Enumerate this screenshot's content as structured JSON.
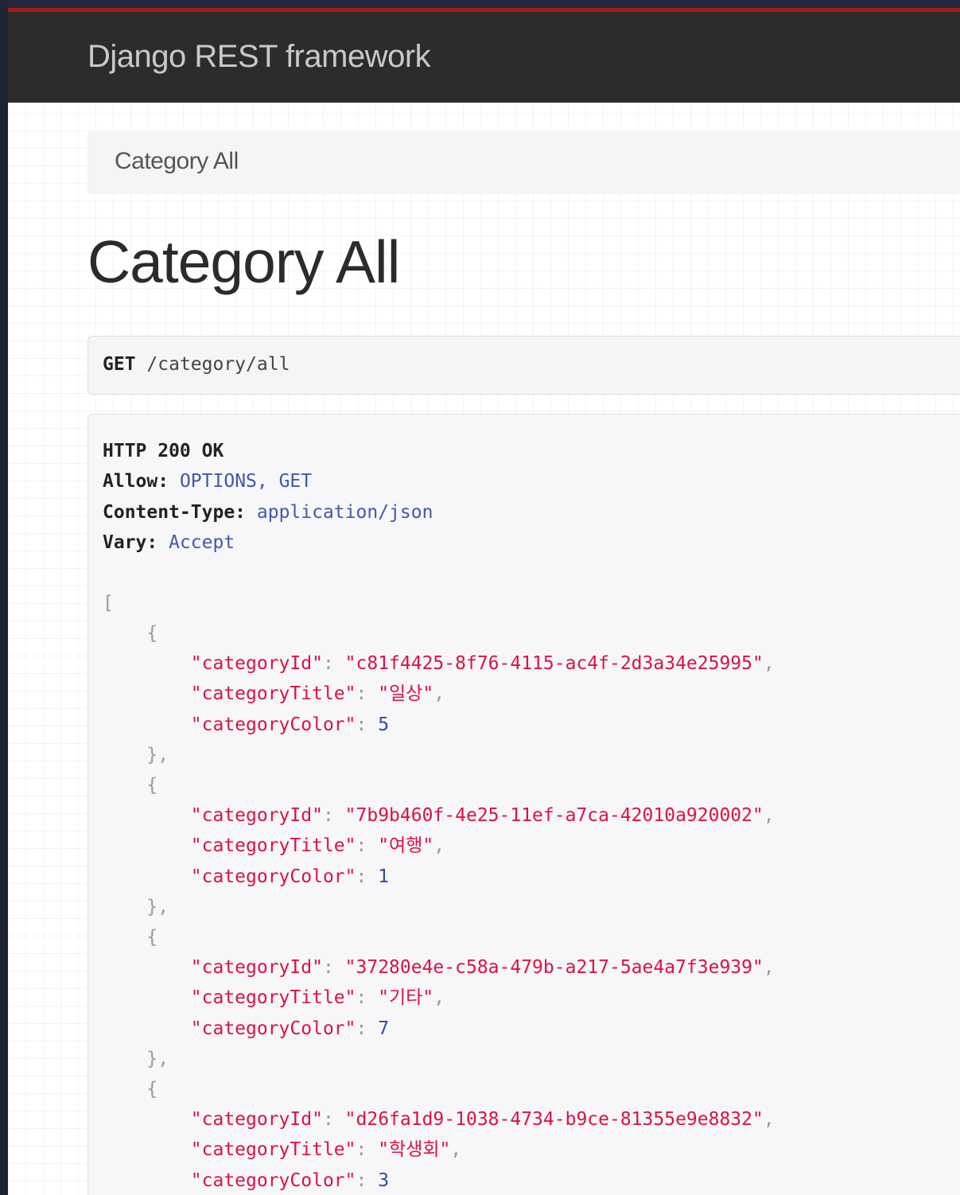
{
  "navbar": {
    "brand": "Django REST framework"
  },
  "breadcrumb": {
    "current": "Category All"
  },
  "page": {
    "title": "Category All"
  },
  "request": {
    "method": "GET",
    "path": "/category/all"
  },
  "response": {
    "status_line": "HTTP 200 OK",
    "headers": [
      {
        "name": "Allow:",
        "value": "OPTIONS, GET"
      },
      {
        "name": "Content-Type:",
        "value": "application/json"
      },
      {
        "name": "Vary:",
        "value": "Accept"
      }
    ],
    "body": {
      "items": [
        {
          "id_key": "\"categoryId\"",
          "id": "\"c81f4425-8f76-4115-ac4f-2d3a34e25995\"",
          "title_key": "\"categoryTitle\"",
          "title": "\"일상\"",
          "color_key": "\"categoryColor\"",
          "color": "5"
        },
        {
          "id_key": "\"categoryId\"",
          "id": "\"7b9b460f-4e25-11ef-a7ca-42010a920002\"",
          "title_key": "\"categoryTitle\"",
          "title": "\"여행\"",
          "color_key": "\"categoryColor\"",
          "color": "1"
        },
        {
          "id_key": "\"categoryId\"",
          "id": "\"37280e4e-c58a-479b-a217-5ae4a7f3e939\"",
          "title_key": "\"categoryTitle\"",
          "title": "\"기타\"",
          "color_key": "\"categoryColor\"",
          "color": "7"
        },
        {
          "id_key": "\"categoryId\"",
          "id": "\"d26fa1d9-1038-4734-b9ce-81355e9e8832\"",
          "title_key": "\"categoryTitle\"",
          "title": "\"학생회\"",
          "color_key": "\"categoryColor\"",
          "color": "3"
        }
      ]
    }
  }
}
